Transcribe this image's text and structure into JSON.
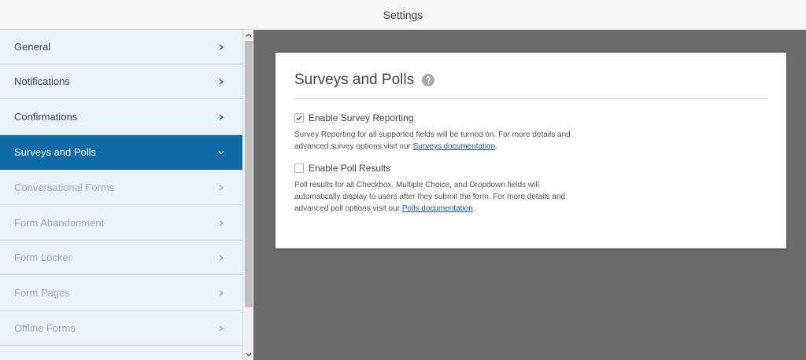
{
  "window": {
    "title": "Settings"
  },
  "sidebar": {
    "items": [
      {
        "label": "General",
        "state": "normal"
      },
      {
        "label": "Notifications",
        "state": "normal"
      },
      {
        "label": "Confirmations",
        "state": "normal"
      },
      {
        "label": "Surveys and Polls",
        "state": "active"
      },
      {
        "label": "Conversational Forms",
        "state": "disabled"
      },
      {
        "label": "Form Abandonment",
        "state": "disabled"
      },
      {
        "label": "Form Locker",
        "state": "disabled"
      },
      {
        "label": "Form Pages",
        "state": "disabled"
      },
      {
        "label": "Offline Forms",
        "state": "disabled"
      }
    ]
  },
  "panel": {
    "title": "Surveys and Polls",
    "help_icon": "question-circle-icon",
    "survey": {
      "label": "Enable Survey Reporting",
      "checked": true,
      "desc_before": "Survey Reporting for all supported fields will be turned on. For more details and advanced survey options visit our ",
      "link": "Surveys documentation",
      "desc_after": "."
    },
    "poll": {
      "label": "Enable Poll Results",
      "checked": false,
      "desc_before": "Poll results for all Checkbox, Multiple Choice, and Dropdown fields will automatically display to users after they submit the form. For more details and advanced poll options visit our ",
      "link": "Polls documentation",
      "desc_after": "."
    }
  },
  "colors": {
    "active_bg": "#0e6ba8",
    "sidebar_bg": "#ebf3fc",
    "main_bg": "#6b6a6d",
    "link": "#1a56c4"
  }
}
